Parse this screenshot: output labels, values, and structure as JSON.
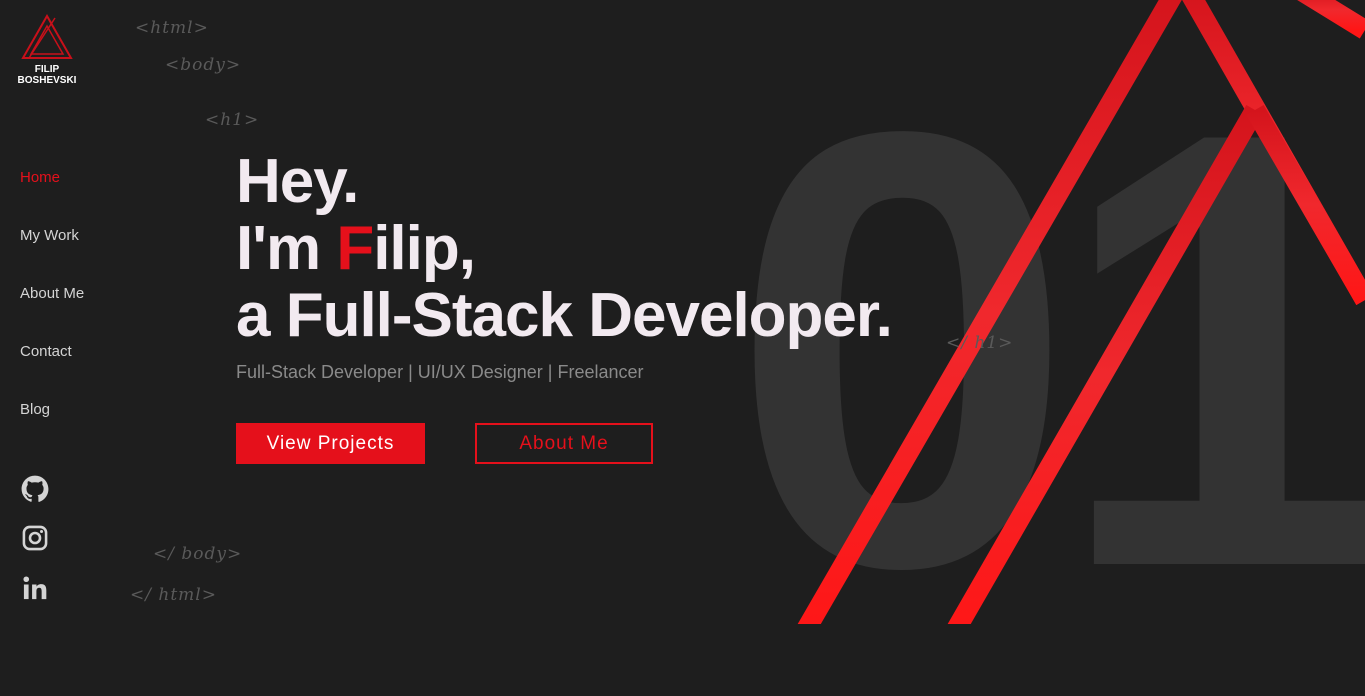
{
  "logo": {
    "line1": "FILIP",
    "line2": "BOSHEVSKI",
    "icon": "triangle-logo-icon"
  },
  "nav": {
    "items": [
      {
        "label": "Home",
        "active": true
      },
      {
        "label": "My Work",
        "active": false
      },
      {
        "label": "About Me",
        "active": false
      },
      {
        "label": "Contact",
        "active": false
      },
      {
        "label": "Blog",
        "active": false
      }
    ]
  },
  "social": {
    "icons": [
      "github-icon",
      "instagram-icon",
      "linkedin-icon"
    ]
  },
  "tags": {
    "html_open": "<html>",
    "body_open": "<body>",
    "h1_open": "<h1>",
    "h1_close": "</ h1>",
    "body_close": "</ body>",
    "html_close": "</ html>"
  },
  "hero": {
    "line1": "Hey.",
    "line2_prefix": "I'm ",
    "line2_accent": "F",
    "line2_suffix": "ilip,",
    "line3": "a Full-Stack Developer.",
    "subtitle": "Full-Stack Developer | UI/UX Designer | Freelancer"
  },
  "buttons": {
    "primary": "View Projects",
    "secondary": "About Me"
  },
  "background": {
    "big_number": "01"
  },
  "colors": {
    "accent": "#e5101b",
    "background": "#1e1e1e",
    "heading": "#f2eaf0",
    "muted": "#8a8a8a"
  }
}
